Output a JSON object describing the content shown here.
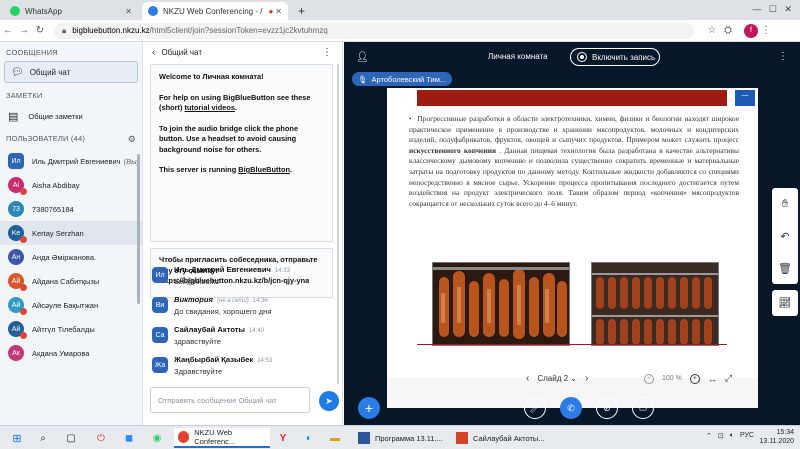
{
  "browser": {
    "tabs": [
      {
        "label": "WhatsApp",
        "close": "✕"
      },
      {
        "label": "NKZU Web Conferencing - /",
        "close": "✕"
      }
    ],
    "new_tab": "+",
    "url_host": "bigbluebutton.nkzu.kz",
    "url_rest": "/html5client/join?sessionToken=evzz1jc2kvtuhmzq",
    "profile_initial": "f"
  },
  "sidebar": {
    "messages_title": "СООБЩЕНИЯ",
    "public_chat": "Общий чат",
    "notes_title": "ЗАМЕТКИ",
    "shared_notes": "Общие заметки",
    "users_title": "ПОЛЬЗОВАТЕЛИ (44)",
    "users": [
      {
        "initials": "Ил",
        "name": "Иль Дмитрий Евгениевич",
        "suffix": "(Вы)",
        "color": "#2e66b7",
        "square": true,
        "mic": false
      },
      {
        "initials": "Ai",
        "name": "Aisha Abdibay",
        "suffix": "",
        "color": "#c62e6e",
        "square": false,
        "mic": true
      },
      {
        "initials": "73",
        "name": "7380765184",
        "suffix": "",
        "color": "#2a8ab7",
        "square": false,
        "mic": false
      },
      {
        "initials": "Ke",
        "name": "Kertay Serzhan",
        "suffix": "",
        "color": "#1f5f9b",
        "square": false,
        "mic": true
      },
      {
        "initials": "Ан",
        "name": "Анда Әміржанова.",
        "suffix": "",
        "color": "#3d57a8",
        "square": false,
        "mic": false
      },
      {
        "initials": "Ай",
        "name": "Айдана Сабитқызы",
        "suffix": "",
        "color": "#d8572a",
        "square": false,
        "mic": true
      },
      {
        "initials": "Ай",
        "name": "Айсәуле Бақытжан",
        "suffix": "",
        "color": "#2e9bc4",
        "square": false,
        "mic": true
      },
      {
        "initials": "Ай",
        "name": "Айтгүл Тілебалды",
        "suffix": "",
        "color": "#1f5f9b",
        "square": false,
        "mic": true
      },
      {
        "initials": "Ак",
        "name": "Акдана Умарова",
        "suffix": "",
        "color": "#c2367a",
        "square": false,
        "mic": false
      }
    ]
  },
  "chat": {
    "back": "‹",
    "title": "Общий чат",
    "menu": "⋮",
    "welcome_prefix": "Welcome to ",
    "welcome_room": "Личная комната",
    "welcome_suffix": "!",
    "help_text": "For help on using BigBlueButton see these (short) ",
    "help_link": "tutorial videos",
    "help_end": ".",
    "audio_text": "To join the audio bridge click the phone button. Use a headset to avoid causing background noise for others.",
    "server_text": "This server is running ",
    "server_link": "BigBlueButton",
    "server_end": ".",
    "invite_text": "Чтобы пригласить собеседника, отправьте ему эту ссылку:",
    "invite_link": "https://bigbluebutton.nkzu.kz/b/jcn-qjy-yna",
    "messages": [
      {
        "initials": "Ил",
        "name": "Иль Дмитрий Евгениевич",
        "time": "14:33",
        "text": "deil@nkzu.kz",
        "color": "#2e66b7"
      },
      {
        "initials": "Ви",
        "name": "Виктория",
        "status": "(не в сети)",
        "time": "14:36",
        "text": "До свидания, хорошего дня",
        "color": "#2e66b7"
      },
      {
        "initials": "Са",
        "name": "Сайлаубай Актоты",
        "time": "14:40",
        "text": "здравствуйте",
        "color": "#2e66b7"
      },
      {
        "initials": "Жа",
        "name": "Жаңбырбай Қазыбек",
        "time": "14:53",
        "text": "Здравствуйте",
        "color": "#2e66b7"
      }
    ],
    "input_placeholder": "Отправить сообщение Общий чат",
    "send": "➤"
  },
  "main": {
    "room_title": "Личная комната",
    "record_label": "Включить запись",
    "talker": "Артоболевский Тим...",
    "slide": {
      "bullet": "•",
      "text_pre": "Прогрессивные разработки в области электротехники, химии, физики и биологии находят широкое практическое применение в производстве и хранении мясопродуктов, молочных и кондитерских изделий, полуфабрикатов, фруктов, овощей и сыпучих продуктов. Примером может служить процесс ",
      "text_bold": "искусственного копчения",
      "text_post": " . Данная пищевая технология была разработана в качестве альтернативы классическому дымовому копчению и позволила существенно сократить временные и материальные затраты на подготовку продуктов по данному методу. Коптильные жидкости добавляются со специями непосредственно в мясное сырье. Ускорение процесса пропитывания последнего достигается путем воздействия на продукт электрического поля. Таким образом период «копчения» мясопродуктов сокращается от нескольких суток всего до 4–6 минут.",
      "corner": "—"
    },
    "slide_nav": {
      "prev": "‹",
      "label": "Слайд 2",
      "caret": "⌄",
      "next": "›"
    },
    "zoom": {
      "minus": "−",
      "value": "100 %",
      "plus": "+",
      "fit": "↔",
      "full": "⤢"
    }
  },
  "taskbar": {
    "windows": [
      {
        "label": "NKZU Web Conferenc...",
        "color": "#1e6fd9"
      },
      {
        "label": "Программа 13.11....",
        "color": "#2b579a"
      },
      {
        "label": "Сайлаубай Актоты...",
        "color": "#d04423"
      }
    ],
    "lang": "РУС",
    "time": "15:34",
    "date": "13.11.2020"
  }
}
